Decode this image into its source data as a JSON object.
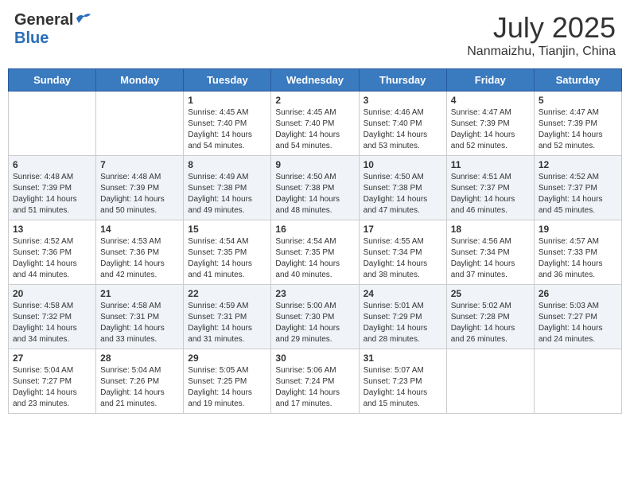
{
  "header": {
    "logo_general": "General",
    "logo_blue": "Blue",
    "month": "July 2025",
    "location": "Nanmaizhu, Tianjin, China"
  },
  "calendar": {
    "days_of_week": [
      "Sunday",
      "Monday",
      "Tuesday",
      "Wednesday",
      "Thursday",
      "Friday",
      "Saturday"
    ],
    "weeks": [
      [
        {
          "day": "",
          "sunrise": "",
          "sunset": "",
          "daylight": ""
        },
        {
          "day": "",
          "sunrise": "",
          "sunset": "",
          "daylight": ""
        },
        {
          "day": "1",
          "sunrise": "Sunrise: 4:45 AM",
          "sunset": "Sunset: 7:40 PM",
          "daylight": "Daylight: 14 hours and 54 minutes."
        },
        {
          "day": "2",
          "sunrise": "Sunrise: 4:45 AM",
          "sunset": "Sunset: 7:40 PM",
          "daylight": "Daylight: 14 hours and 54 minutes."
        },
        {
          "day": "3",
          "sunrise": "Sunrise: 4:46 AM",
          "sunset": "Sunset: 7:40 PM",
          "daylight": "Daylight: 14 hours and 53 minutes."
        },
        {
          "day": "4",
          "sunrise": "Sunrise: 4:47 AM",
          "sunset": "Sunset: 7:39 PM",
          "daylight": "Daylight: 14 hours and 52 minutes."
        },
        {
          "day": "5",
          "sunrise": "Sunrise: 4:47 AM",
          "sunset": "Sunset: 7:39 PM",
          "daylight": "Daylight: 14 hours and 52 minutes."
        }
      ],
      [
        {
          "day": "6",
          "sunrise": "Sunrise: 4:48 AM",
          "sunset": "Sunset: 7:39 PM",
          "daylight": "Daylight: 14 hours and 51 minutes."
        },
        {
          "day": "7",
          "sunrise": "Sunrise: 4:48 AM",
          "sunset": "Sunset: 7:39 PM",
          "daylight": "Daylight: 14 hours and 50 minutes."
        },
        {
          "day": "8",
          "sunrise": "Sunrise: 4:49 AM",
          "sunset": "Sunset: 7:38 PM",
          "daylight": "Daylight: 14 hours and 49 minutes."
        },
        {
          "day": "9",
          "sunrise": "Sunrise: 4:50 AM",
          "sunset": "Sunset: 7:38 PM",
          "daylight": "Daylight: 14 hours and 48 minutes."
        },
        {
          "day": "10",
          "sunrise": "Sunrise: 4:50 AM",
          "sunset": "Sunset: 7:38 PM",
          "daylight": "Daylight: 14 hours and 47 minutes."
        },
        {
          "day": "11",
          "sunrise": "Sunrise: 4:51 AM",
          "sunset": "Sunset: 7:37 PM",
          "daylight": "Daylight: 14 hours and 46 minutes."
        },
        {
          "day": "12",
          "sunrise": "Sunrise: 4:52 AM",
          "sunset": "Sunset: 7:37 PM",
          "daylight": "Daylight: 14 hours and 45 minutes."
        }
      ],
      [
        {
          "day": "13",
          "sunrise": "Sunrise: 4:52 AM",
          "sunset": "Sunset: 7:36 PM",
          "daylight": "Daylight: 14 hours and 44 minutes."
        },
        {
          "day": "14",
          "sunrise": "Sunrise: 4:53 AM",
          "sunset": "Sunset: 7:36 PM",
          "daylight": "Daylight: 14 hours and 42 minutes."
        },
        {
          "day": "15",
          "sunrise": "Sunrise: 4:54 AM",
          "sunset": "Sunset: 7:35 PM",
          "daylight": "Daylight: 14 hours and 41 minutes."
        },
        {
          "day": "16",
          "sunrise": "Sunrise: 4:54 AM",
          "sunset": "Sunset: 7:35 PM",
          "daylight": "Daylight: 14 hours and 40 minutes."
        },
        {
          "day": "17",
          "sunrise": "Sunrise: 4:55 AM",
          "sunset": "Sunset: 7:34 PM",
          "daylight": "Daylight: 14 hours and 38 minutes."
        },
        {
          "day": "18",
          "sunrise": "Sunrise: 4:56 AM",
          "sunset": "Sunset: 7:34 PM",
          "daylight": "Daylight: 14 hours and 37 minutes."
        },
        {
          "day": "19",
          "sunrise": "Sunrise: 4:57 AM",
          "sunset": "Sunset: 7:33 PM",
          "daylight": "Daylight: 14 hours and 36 minutes."
        }
      ],
      [
        {
          "day": "20",
          "sunrise": "Sunrise: 4:58 AM",
          "sunset": "Sunset: 7:32 PM",
          "daylight": "Daylight: 14 hours and 34 minutes."
        },
        {
          "day": "21",
          "sunrise": "Sunrise: 4:58 AM",
          "sunset": "Sunset: 7:31 PM",
          "daylight": "Daylight: 14 hours and 33 minutes."
        },
        {
          "day": "22",
          "sunrise": "Sunrise: 4:59 AM",
          "sunset": "Sunset: 7:31 PM",
          "daylight": "Daylight: 14 hours and 31 minutes."
        },
        {
          "day": "23",
          "sunrise": "Sunrise: 5:00 AM",
          "sunset": "Sunset: 7:30 PM",
          "daylight": "Daylight: 14 hours and 29 minutes."
        },
        {
          "day": "24",
          "sunrise": "Sunrise: 5:01 AM",
          "sunset": "Sunset: 7:29 PM",
          "daylight": "Daylight: 14 hours and 28 minutes."
        },
        {
          "day": "25",
          "sunrise": "Sunrise: 5:02 AM",
          "sunset": "Sunset: 7:28 PM",
          "daylight": "Daylight: 14 hours and 26 minutes."
        },
        {
          "day": "26",
          "sunrise": "Sunrise: 5:03 AM",
          "sunset": "Sunset: 7:27 PM",
          "daylight": "Daylight: 14 hours and 24 minutes."
        }
      ],
      [
        {
          "day": "27",
          "sunrise": "Sunrise: 5:04 AM",
          "sunset": "Sunset: 7:27 PM",
          "daylight": "Daylight: 14 hours and 23 minutes."
        },
        {
          "day": "28",
          "sunrise": "Sunrise: 5:04 AM",
          "sunset": "Sunset: 7:26 PM",
          "daylight": "Daylight: 14 hours and 21 minutes."
        },
        {
          "day": "29",
          "sunrise": "Sunrise: 5:05 AM",
          "sunset": "Sunset: 7:25 PM",
          "daylight": "Daylight: 14 hours and 19 minutes."
        },
        {
          "day": "30",
          "sunrise": "Sunrise: 5:06 AM",
          "sunset": "Sunset: 7:24 PM",
          "daylight": "Daylight: 14 hours and 17 minutes."
        },
        {
          "day": "31",
          "sunrise": "Sunrise: 5:07 AM",
          "sunset": "Sunset: 7:23 PM",
          "daylight": "Daylight: 14 hours and 15 minutes."
        },
        {
          "day": "",
          "sunrise": "",
          "sunset": "",
          "daylight": ""
        },
        {
          "day": "",
          "sunrise": "",
          "sunset": "",
          "daylight": ""
        }
      ]
    ]
  }
}
